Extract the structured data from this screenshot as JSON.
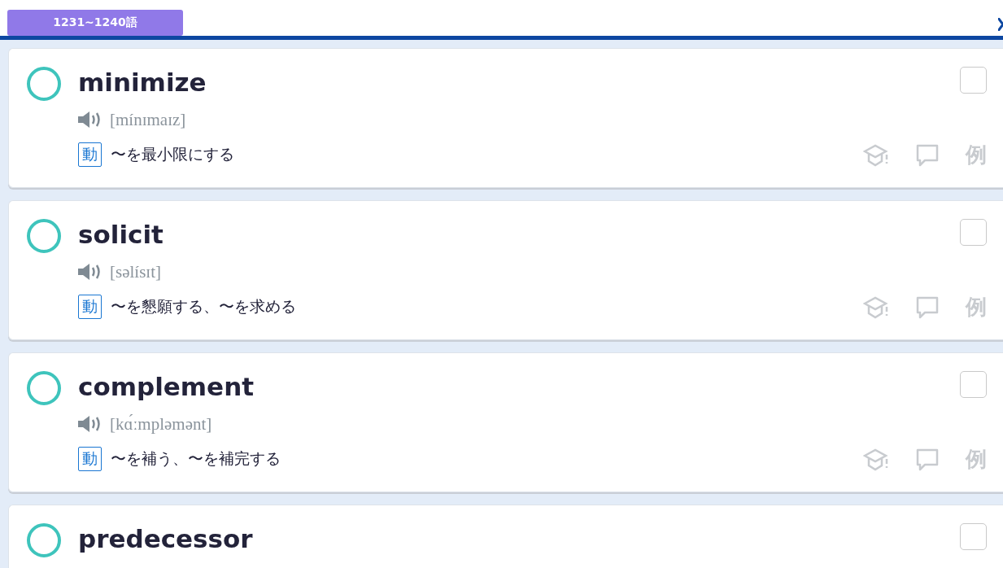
{
  "header": {
    "range_label": "1231~1240語"
  },
  "words": [
    {
      "word": "minimize",
      "mastered": false,
      "checked": false,
      "phonetic": "[mínɪmaɪz]",
      "pos": "動",
      "meaning": "〜を最小限にする",
      "example_label": "例"
    },
    {
      "word": "solicit",
      "mastered": false,
      "checked": false,
      "phonetic": "[səlísɪt]",
      "pos": "動",
      "meaning": "〜を懇願する、〜を求める",
      "example_label": "例"
    },
    {
      "word": "complement",
      "mastered": false,
      "checked": false,
      "phonetic": "[kɑ́ːmpləmənt]",
      "pos": "動",
      "meaning": "〜を補う、〜を補完する",
      "example_label": "例"
    },
    {
      "word": "predecessor",
      "mastered": false,
      "checked": false
    }
  ]
}
